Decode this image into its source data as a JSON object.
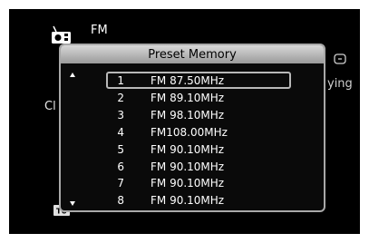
{
  "header": {
    "source": "FM",
    "icon": "radio-icon"
  },
  "background": {
    "partial_right_text": "ying",
    "partial_left_text": "Cl",
    "badge": "TU"
  },
  "popup": {
    "title": "Preset Memory",
    "selected_index": 0,
    "scroll_up_icon": "triangle-up-icon",
    "scroll_down_icon": "triangle-down-icon",
    "items": [
      {
        "number": "1",
        "frequency": "FM 87.50MHz"
      },
      {
        "number": "2",
        "frequency": "FM 89.10MHz"
      },
      {
        "number": "3",
        "frequency": "FM 98.10MHz"
      },
      {
        "number": "4",
        "frequency": "FM108.00MHz"
      },
      {
        "number": "5",
        "frequency": "FM 90.10MHz"
      },
      {
        "number": "6",
        "frequency": "FM 90.10MHz"
      },
      {
        "number": "7",
        "frequency": "FM 90.10MHz"
      },
      {
        "number": "8",
        "frequency": "FM 90.10MHz"
      }
    ]
  }
}
